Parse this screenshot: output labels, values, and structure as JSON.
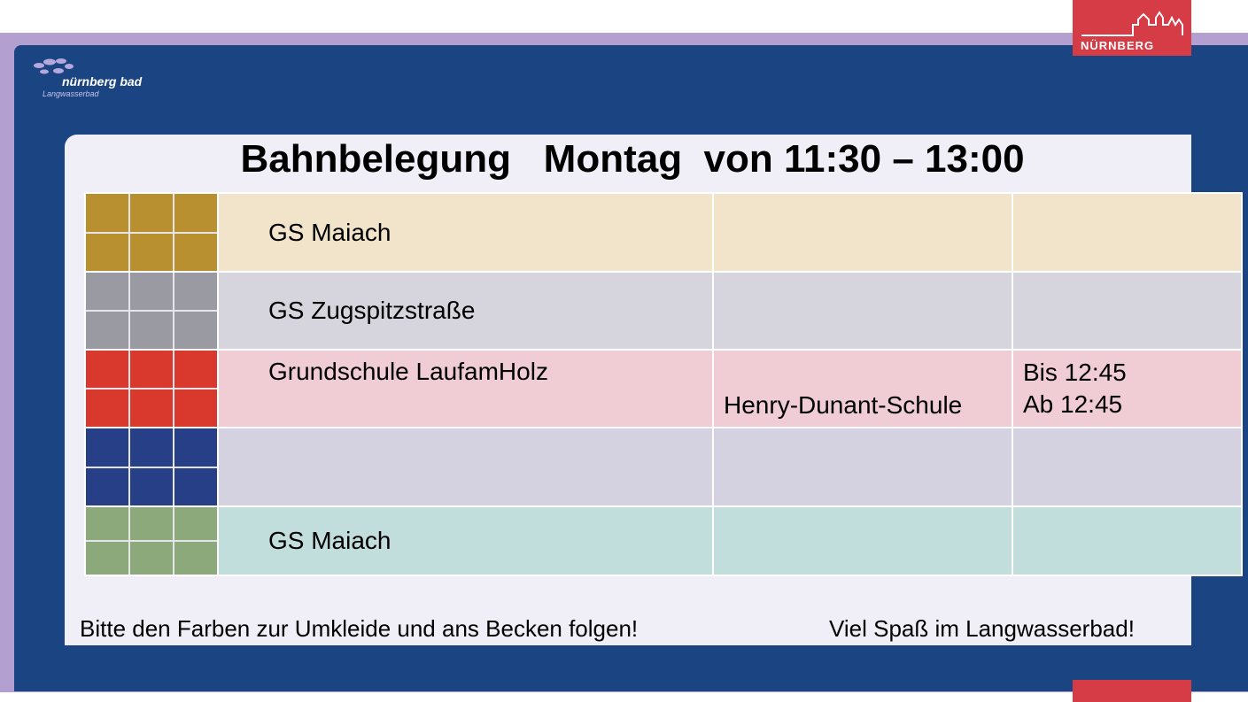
{
  "header": {
    "city_label": "NÜRNBERG",
    "logo_name": "nürnberg bad",
    "logo_subtitle": "Langwasserbad"
  },
  "title": "Bahnbelegung   Montag  von 11:30 – 13:00",
  "lanes": [
    {
      "color": "#b8902f",
      "bg": "#f1e4ca",
      "col1": "GS Maiach",
      "col2": "",
      "col3_line1": "",
      "col3_line2": ""
    },
    {
      "color": "#9a9aa2",
      "bg": "#d6d5de",
      "col1": "GS Zugspitzstraße",
      "col2": "",
      "col3_line1": "",
      "col3_line2": ""
    },
    {
      "color": "#d8392c",
      "bg": "#f0ccd4",
      "col1": "Grundschule LaufamHolz",
      "col2": "Henry-Dunant-Schule",
      "col3_line1": "Bis 12:45",
      "col3_line2": "Ab 12:45"
    },
    {
      "color": "#273f86",
      "bg": "#d4d1e0",
      "col1": "",
      "col2": "",
      "col3_line1": "",
      "col3_line2": ""
    },
    {
      "color": "#8ca97c",
      "bg": "#c2dedc",
      "col1": "GS Maiach",
      "col2": "",
      "col3_line1": "",
      "col3_line2": ""
    }
  ],
  "footer": {
    "left": "Bitte den Farben zur Umkleide und ans Becken folgen!",
    "right": "Viel Spaß im Langwasserbad!"
  }
}
